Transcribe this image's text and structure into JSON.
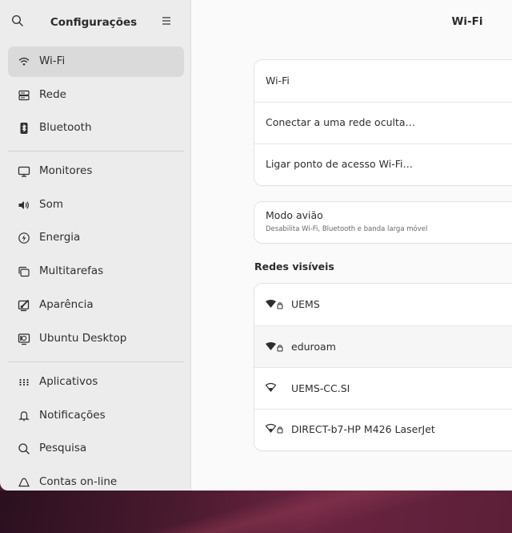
{
  "sidebar": {
    "title": "Configurações",
    "items": [
      {
        "label": "Wi-Fi",
        "icon": "wifi-icon",
        "selected": true
      },
      {
        "label": "Rede",
        "icon": "network-icon"
      },
      {
        "label": "Bluetooth",
        "icon": "bluetooth-icon"
      },
      {
        "label": "Monitores",
        "icon": "monitor-icon"
      },
      {
        "label": "Som",
        "icon": "speaker-icon"
      },
      {
        "label": "Energia",
        "icon": "power-icon"
      },
      {
        "label": "Multitarefas",
        "icon": "multitasking-icon"
      },
      {
        "label": "Aparência",
        "icon": "appearance-icon"
      },
      {
        "label": "Ubuntu Desktop",
        "icon": "ubuntu-desktop-icon"
      },
      {
        "label": "Aplicativos",
        "icon": "apps-grid-icon"
      },
      {
        "label": "Notificações",
        "icon": "bell-icon"
      },
      {
        "label": "Pesquisa",
        "icon": "search-icon"
      },
      {
        "label": "Contas on-line",
        "icon": "cloud-icon"
      }
    ]
  },
  "content": {
    "title": "Wi-Fi",
    "wifi_card": {
      "wifi_label": "Wi-Fi",
      "hidden_network_label": "Conectar a uma rede oculta…",
      "hotspot_label": "Ligar ponto de acesso Wi-Fi…"
    },
    "airplane_card": {
      "label": "Modo avião",
      "description": "Desabilita Wi-Fi, Bluetooth e banda larga móvel"
    },
    "networks_title": "Redes visíveis",
    "networks": [
      {
        "name": "UEMS",
        "secured": true,
        "strength": "full"
      },
      {
        "name": "eduroam",
        "secured": true,
        "strength": "full"
      },
      {
        "name": "UEMS-CC.SI",
        "secured": false,
        "strength": "weak"
      },
      {
        "name": "DIRECT-b7-HP M426 LaserJet",
        "secured": true,
        "strength": "weak"
      }
    ]
  },
  "colors": {
    "sidebar_bg": "#ececec",
    "selected_bg": "#dadada",
    "content_bg": "#fafafa",
    "card_bg": "#ffffff",
    "wallpaper": "#4a1c2c"
  }
}
